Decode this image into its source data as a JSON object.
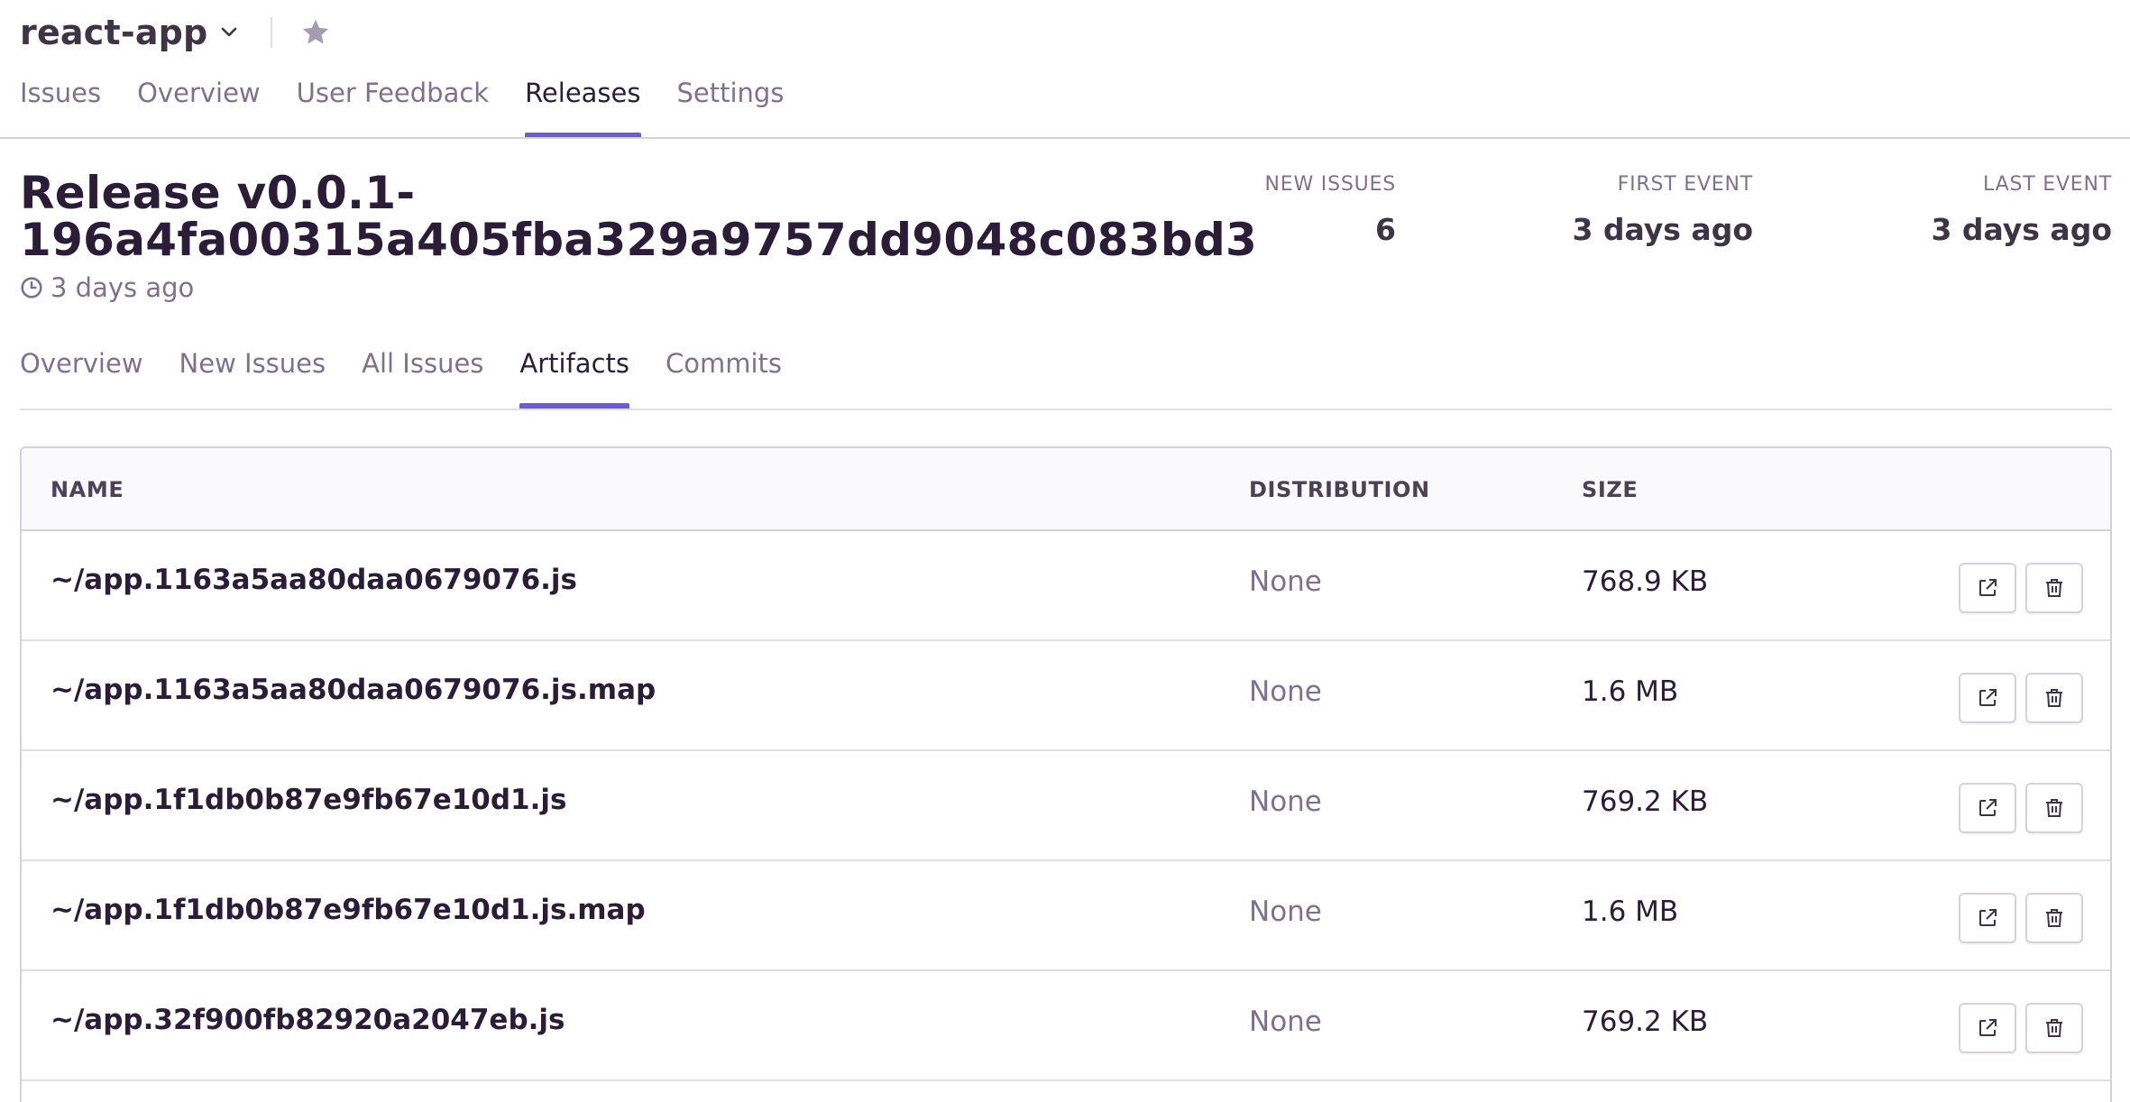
{
  "project": {
    "name": "react-app",
    "chevron_icon": "chevron-down-icon",
    "star_icon": "star-icon"
  },
  "top_nav": {
    "tabs": [
      {
        "label": "Issues",
        "active": false
      },
      {
        "label": "Overview",
        "active": false
      },
      {
        "label": "User Feedback",
        "active": false
      },
      {
        "label": "Releases",
        "active": true
      },
      {
        "label": "Settings",
        "active": false
      }
    ]
  },
  "release": {
    "title_line1": "Release v0.0.1-",
    "title_line2": "196a4fa00315a405fba329a9757dd9048c083bd3",
    "age": "3 days ago",
    "stats": {
      "new_issues_label": "NEW ISSUES",
      "new_issues_value": "6",
      "first_event_label": "FIRST EVENT",
      "first_event_value": "3 days ago",
      "last_event_label": "LAST EVENT",
      "last_event_value": "3 days ago"
    }
  },
  "release_nav": {
    "tabs": [
      {
        "label": "Overview",
        "active": false
      },
      {
        "label": "New Issues",
        "active": false
      },
      {
        "label": "All Issues",
        "active": false
      },
      {
        "label": "Artifacts",
        "active": true
      },
      {
        "label": "Commits",
        "active": false
      }
    ]
  },
  "artifacts": {
    "columns": {
      "name": "NAME",
      "distribution": "DISTRIBUTION",
      "size": "SIZE"
    },
    "rows": [
      {
        "name": "~/app.1163a5aa80daa0679076.js",
        "distribution": "None",
        "size": "768.9 KB"
      },
      {
        "name": "~/app.1163a5aa80daa0679076.js.map",
        "distribution": "None",
        "size": "1.6 MB"
      },
      {
        "name": "~/app.1f1db0b87e9fb67e10d1.js",
        "distribution": "None",
        "size": "769.2 KB"
      },
      {
        "name": "~/app.1f1db0b87e9fb67e10d1.js.map",
        "distribution": "None",
        "size": "1.6 MB"
      },
      {
        "name": "~/app.32f900fb82920a2047eb.js",
        "distribution": "None",
        "size": "769.2 KB"
      }
    ]
  },
  "colors": {
    "accent": "#6c5fc7",
    "text_primary": "#2b1d38",
    "text_muted": "#80708f",
    "border": "#d6d0dc"
  }
}
